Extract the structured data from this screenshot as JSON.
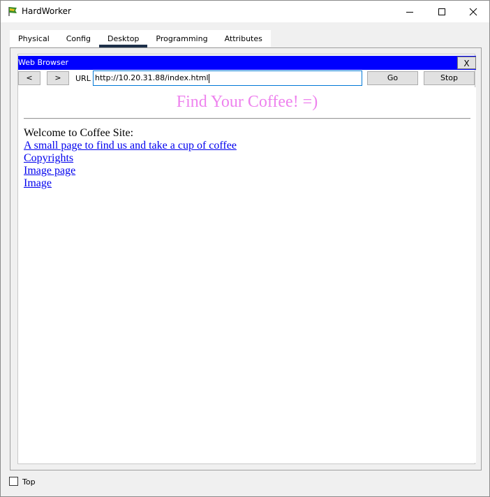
{
  "window": {
    "title": "HardWorker",
    "controls": {
      "minimize": "minimize-icon",
      "maximize": "maximize-icon",
      "close": "close-icon"
    }
  },
  "tabs": [
    {
      "label": "Physical",
      "active": false
    },
    {
      "label": "Config",
      "active": false
    },
    {
      "label": "Desktop",
      "active": true
    },
    {
      "label": "Programming",
      "active": false
    },
    {
      "label": "Attributes",
      "active": false
    }
  ],
  "browser": {
    "title": "Web Browser",
    "close_label": "X",
    "back_label": "<",
    "forward_label": ">",
    "url_label": "URL",
    "url_value": "http://10.20.31.88/index.html",
    "go_label": "Go",
    "stop_label": "Stop",
    "header_color": "#0000ff"
  },
  "page": {
    "title": "Find Your Coffee! =)",
    "title_color": "#ee82ee",
    "welcome": "Welcome to Coffee Site:",
    "links": [
      "A small page to find us and take a cup of coffee",
      "Copyrights",
      "Image page",
      "Image"
    ]
  },
  "footer": {
    "top_label": "Top",
    "top_checked": false
  }
}
